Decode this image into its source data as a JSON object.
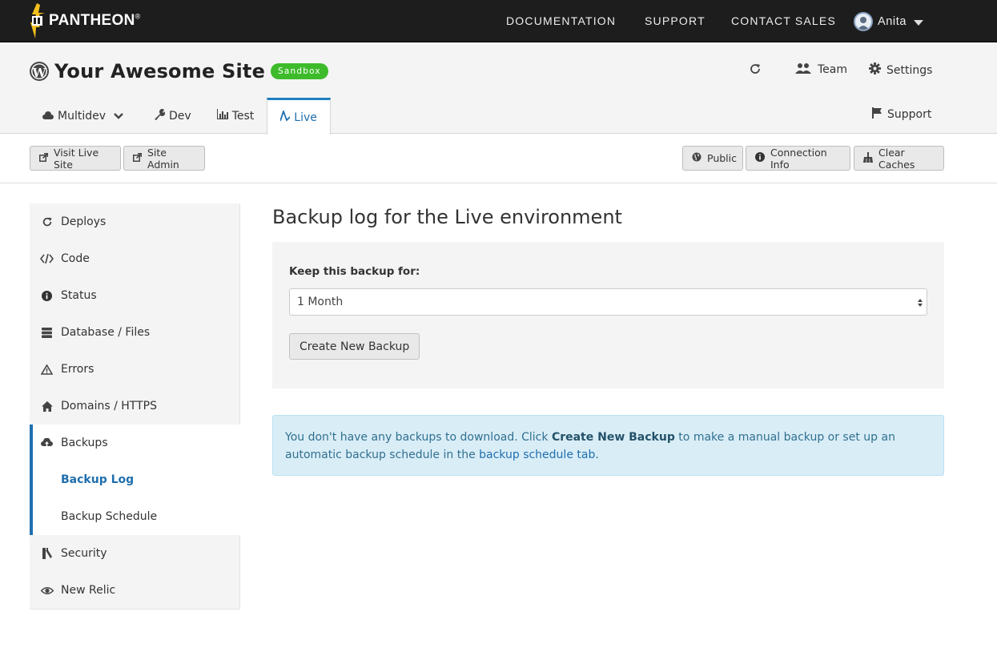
{
  "topnav": {
    "brand": "PANTHEON",
    "links": [
      "DOCUMENTATION",
      "SUPPORT",
      "CONTACT SALES"
    ],
    "user_name": "Anita"
  },
  "site": {
    "title": "Your Awesome Site",
    "badge": "Sandbox",
    "refresh_icon": "refresh-icon",
    "team_label": "Team",
    "settings_label": "Settings",
    "support_label": "Support"
  },
  "tabs": [
    {
      "label": "Multidev",
      "icon": "cloud-icon"
    },
    {
      "label": "Dev",
      "icon": "wrench-icon"
    },
    {
      "label": "Test",
      "icon": "chart-icon"
    },
    {
      "label": "Live",
      "icon": "pulse-icon",
      "active": true
    }
  ],
  "toolbar": {
    "visit_live": "Visit Live Site",
    "site_admin": "Site Admin",
    "public": "Public",
    "connection_info": "Connection Info",
    "clear_caches": "Clear Caches"
  },
  "sidebar": {
    "items": [
      {
        "label": "Deploys",
        "icon": "refresh-icon"
      },
      {
        "label": "Code",
        "icon": "code-icon"
      },
      {
        "label": "Status",
        "icon": "info-icon"
      },
      {
        "label": "Database / Files",
        "icon": "database-icon"
      },
      {
        "label": "Errors",
        "icon": "warning-icon"
      },
      {
        "label": "Domains / HTTPS",
        "icon": "home-icon"
      },
      {
        "label": "Backups",
        "icon": "cloud-upload-icon"
      },
      {
        "label": "Backup Log"
      },
      {
        "label": "Backup Schedule"
      },
      {
        "label": "Security",
        "icon": "key-icon"
      },
      {
        "label": "New Relic",
        "icon": "eye-icon"
      }
    ]
  },
  "main": {
    "title": "Backup log for the Live environment",
    "keep_label": "Keep this backup for:",
    "keep_value": "1 Month",
    "create_button": "Create New Backup",
    "alert": {
      "text1": "You don't have any backups to download. Click ",
      "bold": "Create New Backup",
      "text2": " to make a manual backup or set up an automatic backup schedule in the ",
      "link": "backup schedule tab",
      "text3": "."
    }
  },
  "colors": {
    "accent": "#1f6fae",
    "badge": "#3dbb2a",
    "alert_bg": "#d9edf7",
    "topnav_bg": "#1d1d1d"
  }
}
